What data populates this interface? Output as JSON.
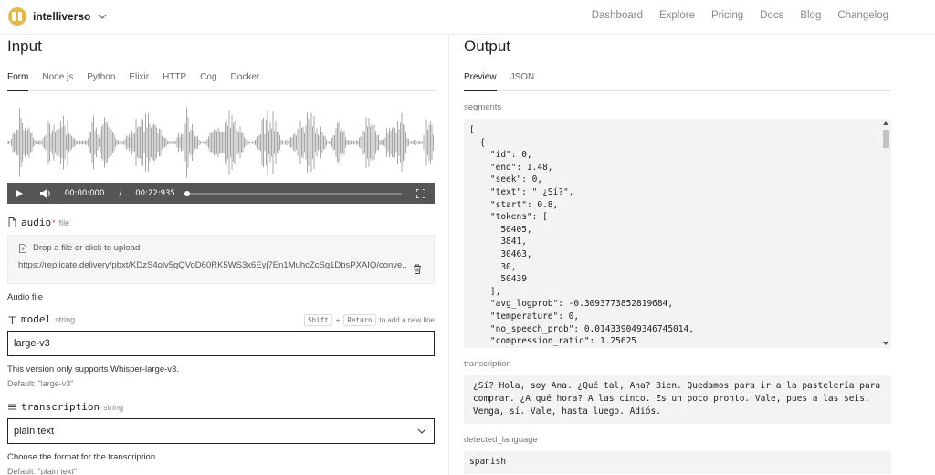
{
  "brand": {
    "name": "intelliverso"
  },
  "nav": [
    "Dashboard",
    "Explore",
    "Pricing",
    "Docs",
    "Blog",
    "Changelog"
  ],
  "input": {
    "title": "Input",
    "tabs": [
      "Form",
      "Node.js",
      "Python",
      "Elixir",
      "HTTP",
      "Cog",
      "Docker"
    ],
    "player": {
      "current_time": "00:00:000",
      "separator": "/",
      "duration": "00:22:935",
      "progress": 0.0
    },
    "audio_field": {
      "name": "audio",
      "required_mark": "*",
      "type": "file",
      "drop_text": "Drop a file or click to upload",
      "url": "https://replicate.delivery/pbxt/KDzS4olv5gQVoD60RK5WS3x6Eyj7En1MuhcZcSg1DbsPXAIQ/conve...",
      "description": "Audio file"
    },
    "model_field": {
      "name": "model",
      "type": "string",
      "hint_key1": "Shift",
      "hint_plus": "+",
      "hint_key2": "Return",
      "hint_text": "to add a new line",
      "value": "large-v3",
      "description": "This version only supports Whisper-large-v3.",
      "default": "Default: \"large-v3\""
    },
    "transcription_field": {
      "name": "transcription",
      "type": "string",
      "value": "plain text",
      "description": "Choose the format for the transcription",
      "default": "Default: \"plain text\""
    }
  },
  "output": {
    "title": "Output",
    "tabs": [
      "Preview",
      "JSON"
    ],
    "segments_label": "segments",
    "segments_json": "[\n  {\n    \"id\": 0,\n    \"end\": 1.48,\n    \"seek\": 0,\n    \"text\": \" ¿Sí?\",\n    \"start\": 0.8,\n    \"tokens\": [\n      50405,\n      3841,\n      30463,\n      30,\n      50439\n    ],\n    \"avg_logprob\": -0.3093773852819684,\n    \"temperature\": 0,\n    \"no_speech_prob\": 0.014339049346745014,\n    \"compression_ratio\": 1.25625",
    "transcription_label": "transcription",
    "transcription": "¿Sí? Hola, soy Ana. ¿Qué tal, Ana? Bien. Quedamos para ir a la pastelería para comprar. ¿A qué hora? A las cinco. Es un poco pronto. Vale, pues a las seis. Venga, sí. Vale, hasta luego. Adiós.",
    "detected_language_label": "detected_language",
    "detected_language": "spanish"
  },
  "colors": {
    "logo": "#e6b74a",
    "player_bg": "#555555",
    "required": "#e03b3b",
    "wave": "#a8a8a8"
  },
  "icons": [
    "chevron-down-icon",
    "play-icon",
    "volume-icon",
    "fullscreen-icon",
    "file-icon",
    "upload-icon",
    "trash-icon",
    "text-icon",
    "list-icon"
  ]
}
